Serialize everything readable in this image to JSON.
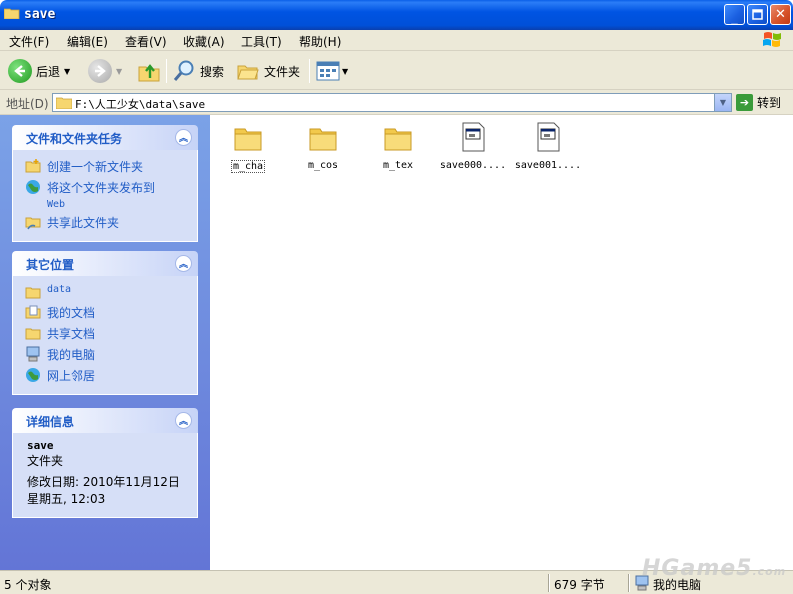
{
  "window": {
    "title": "save"
  },
  "menu": [
    "文件(F)",
    "编辑(E)",
    "查看(V)",
    "收藏(A)",
    "工具(T)",
    "帮助(H)"
  ],
  "toolbar": {
    "back": "后退",
    "search": "搜索",
    "folders": "文件夹"
  },
  "address": {
    "label": "地址(D)",
    "path": "F:\\人工少女\\data\\save",
    "go": "转到"
  },
  "tasks_panel": {
    "title": "文件和文件夹任务",
    "items": [
      {
        "label": "创建一个新文件夹",
        "icon": "new-folder-icon"
      },
      {
        "label": "将这个文件夹发布到",
        "label2": "Web",
        "icon": "publish-web-icon"
      },
      {
        "label": "共享此文件夹",
        "icon": "share-folder-icon"
      }
    ]
  },
  "places_panel": {
    "title": "其它位置",
    "items": [
      {
        "label": "data",
        "icon": "folder-icon"
      },
      {
        "label": "我的文档",
        "icon": "my-documents-icon"
      },
      {
        "label": "共享文档",
        "icon": "shared-documents-icon"
      },
      {
        "label": "我的电脑",
        "icon": "my-computer-icon"
      },
      {
        "label": "网上邻居",
        "icon": "network-places-icon"
      }
    ]
  },
  "details_panel": {
    "title": "详细信息",
    "name": "save",
    "type": "文件夹",
    "modified_line1": "修改日期: 2010年11月12日",
    "modified_line2": "星期五, 12:03"
  },
  "files": [
    {
      "name": "m_cha",
      "type": "folder",
      "selected": true
    },
    {
      "name": "m_cos",
      "type": "folder"
    },
    {
      "name": "m_tex",
      "type": "folder"
    },
    {
      "name": "save000....",
      "type": "file"
    },
    {
      "name": "save001....",
      "type": "file"
    }
  ],
  "status": {
    "objects": "5 个对象",
    "size": "679 字节",
    "location": "我的电脑"
  },
  "watermark": "HGame5",
  "watermark_suffix": ".com",
  "colors": {
    "titlebar": "#0054e3",
    "leftpane": "#7ba2e7",
    "link": "#215dc6"
  }
}
